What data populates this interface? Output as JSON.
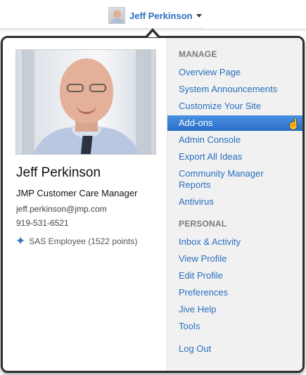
{
  "header": {
    "user_name": "Jeff Perkinson"
  },
  "profile": {
    "name": "Jeff Perkinson",
    "title": "JMP Customer Care Manager",
    "email": "jeff.perkinson@jmp.com",
    "phone": "919-531-6521",
    "status": "SAS Employee (1522 points)"
  },
  "menu": {
    "manage_heading": "MANAGE",
    "manage_items": [
      "Overview Page",
      "System Announcements",
      "Customize Your Site",
      "Add-ons",
      "Admin Console",
      "Export All Ideas",
      "Community Manager Reports",
      "Antivirus"
    ],
    "personal_heading": "PERSONAL",
    "personal_items": [
      "Inbox & Activity",
      "View Profile",
      "Edit Profile",
      "Preferences",
      "Jive Help",
      "Tools"
    ],
    "logout": "Log Out",
    "active_item": "Add-ons"
  },
  "colors": {
    "link": "#2a6fbf",
    "highlight": "#3a82d6",
    "panel_bg": "#f1f1f1"
  },
  "icons": {
    "user_caret": "chevron-down-icon",
    "status": "star-icon",
    "pointer": "hand-cursor-icon"
  }
}
